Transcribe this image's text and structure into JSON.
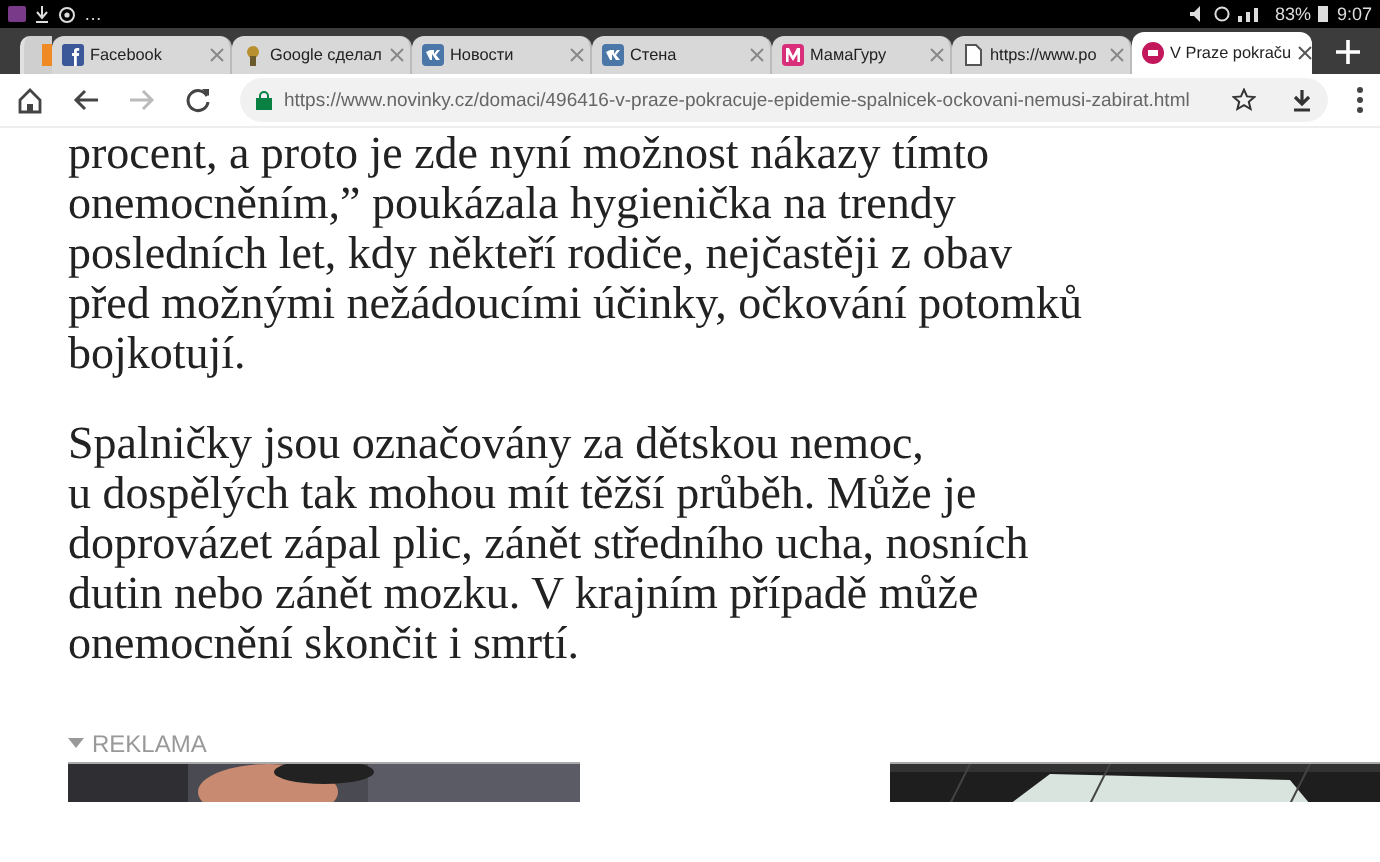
{
  "status_bar": {
    "overflow": "…",
    "battery": "83%",
    "time": "9:07"
  },
  "tabs": [
    {
      "label": "Facebook",
      "selected": false
    },
    {
      "label": "Google сделал",
      "selected": false
    },
    {
      "label": "Новости",
      "selected": false
    },
    {
      "label": "Стена",
      "selected": false
    },
    {
      "label": "МамаГуру",
      "selected": false
    },
    {
      "label": "https://www.po",
      "selected": false
    },
    {
      "label": "V Praze pokraču",
      "selected": true
    }
  ],
  "toolbar": {
    "url": "https://www.novinky.cz/domaci/496416-v-praze-pokracuje-epidemie-spalnicek-ockovani-nemusi-zabirat.html"
  },
  "article": {
    "paragraphs": [
      [
        "procent, a proto je zde nyní možnost nákazy tímto",
        "onemocněním,” poukázala hygienička na trendy",
        "posledních let, kdy někteří rodiče, nejčastěji z obav",
        "před možnými nežádoucími účinky, očkování potomků",
        "bojkotují."
      ],
      [
        "Spalničky jsou označovány za dětskou nemoc,",
        "u dospělých tak mohou mít těžší průběh. Může je",
        "doprovázet zápal plic, zánět středního ucha, nosních",
        "dutin nebo zánět mozku. V krajním případě může",
        "onemocnění skončit i smrtí."
      ]
    ]
  },
  "ad": {
    "label": "REKLAMA"
  }
}
